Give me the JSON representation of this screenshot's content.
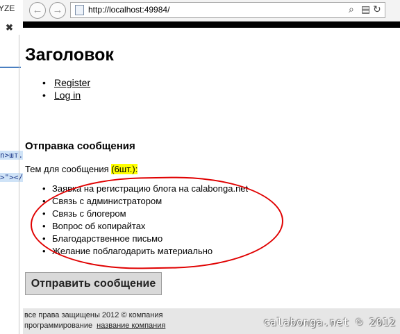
{
  "ide": {
    "title_fragment": "YZE",
    "close_symbol": "✖",
    "code_line_1": "n>шт.",
    "code_line_2": ">\"></u"
  },
  "browser": {
    "back_icon": "←",
    "forward_icon": "→",
    "url": "http://localhost:49984/",
    "search_icon": "⌕",
    "compat_icon": "▤",
    "refresh_icon": "↻"
  },
  "page": {
    "heading": "Заголовок",
    "nav": [
      "Register",
      "Log in"
    ],
    "section_title": "Отправка сообщения",
    "intro_label": "Тем для сообщения",
    "count_label": "(6шт.):",
    "topics": [
      "Заявка на регистрацию блога на calabonga.net",
      "Связь с администратором",
      "Связь с блогером",
      "Вопрос об копирайтах",
      "Благодарственное письмо",
      "Желание поблагодарить материально"
    ],
    "send_button": "Отправить сообщение",
    "footer_line_1": "все права защищены 2012 © компания",
    "footer_line_2": "программирование",
    "footer_link": "название компания"
  },
  "watermark": "calabonga.net © 2012",
  "colors": {
    "highlight": "#ffff00",
    "annotation": "#e00000"
  }
}
